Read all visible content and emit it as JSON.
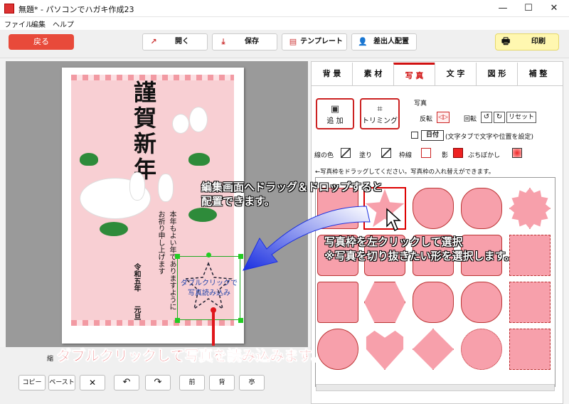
{
  "window": {
    "title": "無題* - パソコンでハガキ作成23",
    "minimize": "—",
    "maximize": "☐",
    "close": "✕"
  },
  "menu": [
    "ファイル",
    "編集",
    "ヘルプ"
  ],
  "toolbar": {
    "back": "戻る",
    "open": "開く",
    "save": "保存",
    "template": "テンプレート",
    "sender": "差出人配置",
    "print": "印刷"
  },
  "card": {
    "greeting": [
      "謹",
      "賀",
      "新",
      "年"
    ],
    "message_col1": "本年もよい年でありますように",
    "message_col2": "お祈り申し上げます",
    "date_col1": "令和五年",
    "date_col2": "元旦",
    "photo_text_line1": "ダブルクリックで",
    "photo_text_line2": "写真読み込み"
  },
  "bottom": {
    "status_left": "縮",
    "status_right": "",
    "copy": "コピー",
    "paste": "ペースト",
    "delete": "✕",
    "undo": "↶",
    "redo": "↷",
    "front": "前",
    "back_order": "背",
    "align": "亭"
  },
  "tabs": [
    "背 景",
    "素 材",
    "写 真",
    "文 字",
    "図 形",
    "補 整"
  ],
  "photo_panel": {
    "add": "追 加",
    "trim": "トリミング",
    "section": "写真",
    "flip": "反転",
    "rotate": "回転",
    "reset": "リセット",
    "date_btn": "日付",
    "date_note": "(文字タブで文字や位置を設定)",
    "line_color": "線の色",
    "fill": "塗り",
    "border": "枠線",
    "shadow": "影",
    "blur": "ぶちぼかし",
    "instruction": "←写真枠をドラッグしてください。写真枠の入れ替えができます。"
  },
  "annotations": {
    "drag_line1": "編集画面へドラッグ＆ドロップすると",
    "drag_line2": "配置できます。",
    "select_line1": "写真枠を左クリックして選択",
    "select_line2": "※写真を切り抜きたい形を選択します。",
    "dblclick": "ダブルクリックして写真を読み込みます。"
  },
  "colors": {
    "accent_red": "#e0161b",
    "card_pink": "#f8cfd3",
    "shape_pink": "#f7a0ab",
    "print_yellow": "#fff7b0"
  }
}
